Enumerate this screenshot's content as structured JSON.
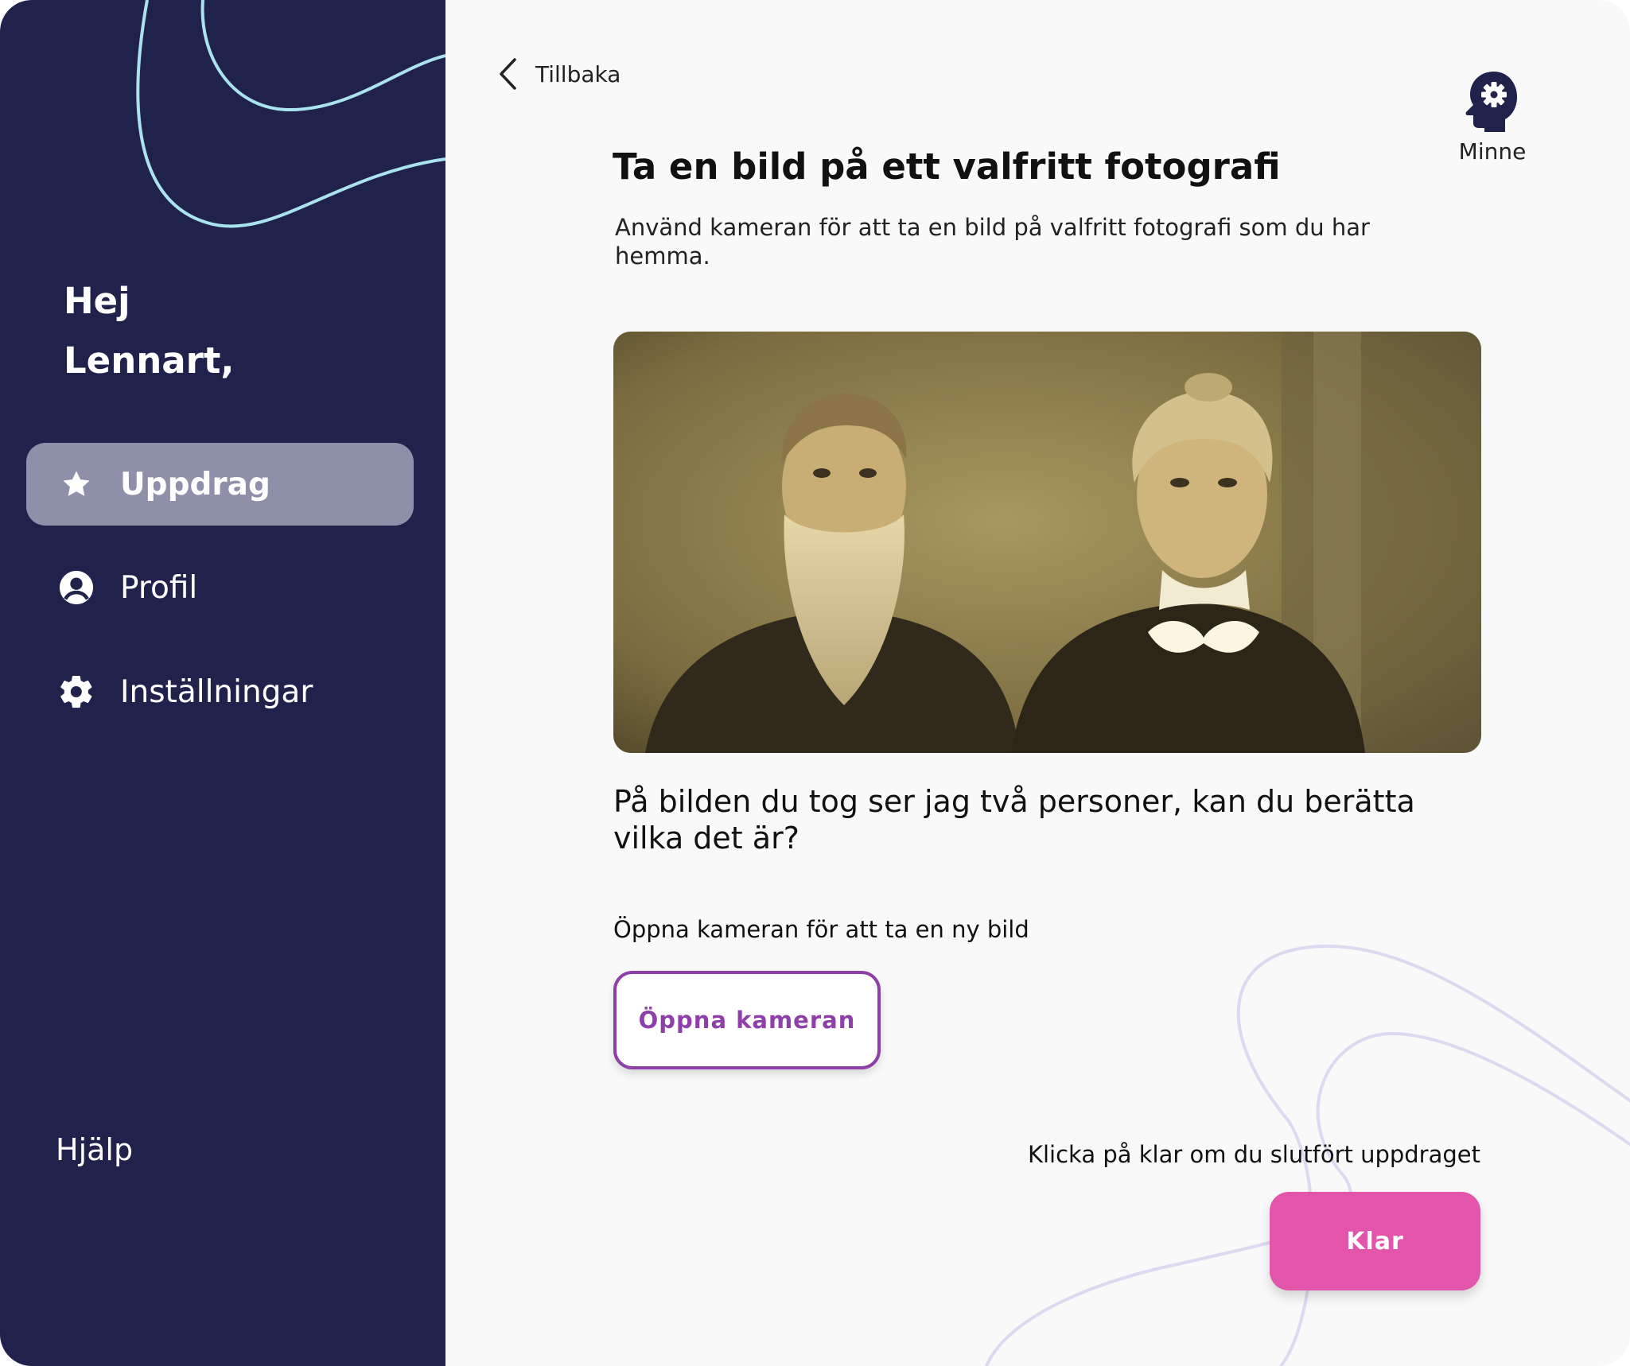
{
  "sidebar": {
    "greeting_line1": "Hej",
    "greeting_line2": "Lennart,",
    "items": [
      {
        "label": "Uppdrag",
        "icon": "star-icon",
        "active": true
      },
      {
        "label": "Profil",
        "icon": "user-circle-icon",
        "active": false
      },
      {
        "label": "Inställningar",
        "icon": "gear-icon",
        "active": false
      }
    ],
    "help_label": "Hjälp",
    "background_color": "#21224c",
    "active_item_color": "#8e8fa8",
    "decor_line_color": "#a9e3ee"
  },
  "header": {
    "back_label": "Tillbaka",
    "back_icon": "chevron-left-icon",
    "memory_label": "Minne",
    "memory_icon": "head-gear-icon"
  },
  "main": {
    "title": "Ta en bild på ett valfritt fotografi",
    "description": "Använd kameran för att ta en bild på valfritt fotografi som du har hemma.",
    "photo": {
      "depicts": "sepia portrait photograph"
    },
    "question": "På bilden du tog ser jag två personer, kan du berätta vilka det är?",
    "camera_hint": "Öppna kameran för att ta en ny bild",
    "open_camera_label": "Öppna kameran",
    "done_hint": "Klicka på klar om du slutfört uppdraget",
    "done_label": "Klar"
  },
  "colors": {
    "accent_purple": "#8e3fa8",
    "accent_pink": "#e255aa",
    "main_background": "#f9f9f9",
    "decor_line_color": "#dcdaf0"
  }
}
